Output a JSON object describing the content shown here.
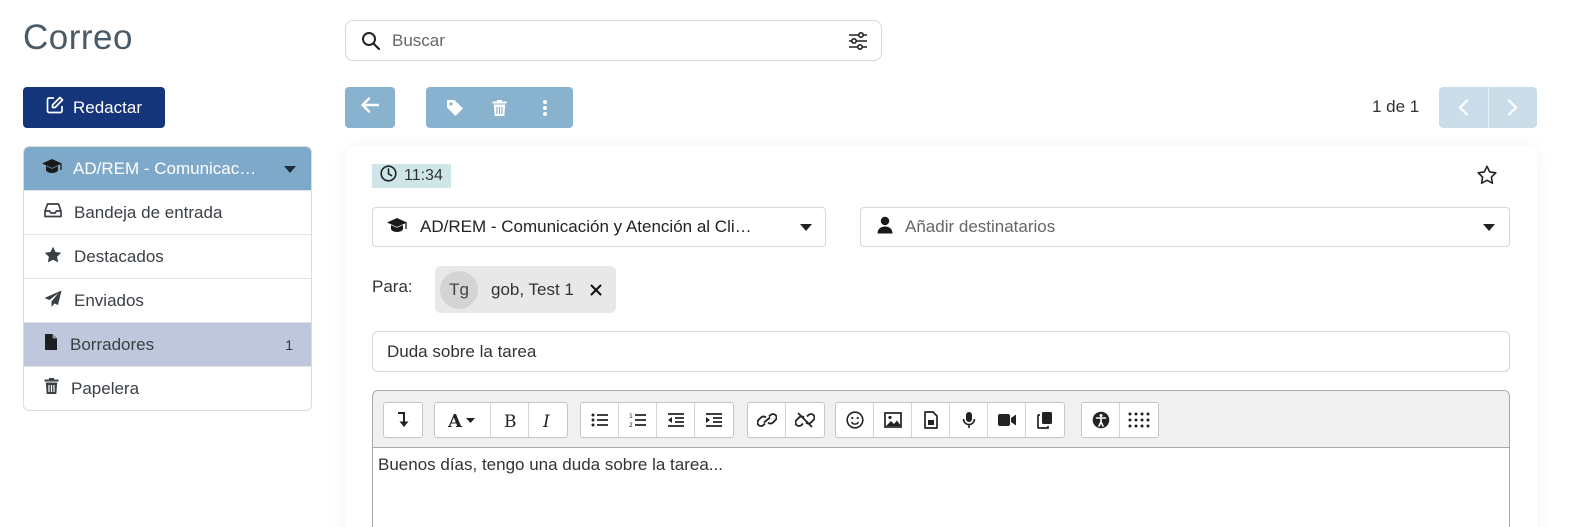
{
  "app": {
    "title": "Correo"
  },
  "search": {
    "placeholder": "Buscar",
    "value": ""
  },
  "compose": {
    "label": "Redactar"
  },
  "sidebar": {
    "account": "AD/REM - Comunicac…",
    "folders": [
      {
        "label": "Bandeja de entrada",
        "icon": "inbox-icon",
        "count": ""
      },
      {
        "label": "Destacados",
        "icon": "star-icon",
        "count": ""
      },
      {
        "label": "Enviados",
        "icon": "paper-plane-icon",
        "count": ""
      },
      {
        "label": "Borradores",
        "icon": "file-icon",
        "count": "1",
        "active": true
      },
      {
        "label": "Papelera",
        "icon": "trash-icon",
        "count": ""
      }
    ]
  },
  "pager": {
    "text": "1 de 1"
  },
  "message": {
    "time": "11:34",
    "from": "AD/REM - Comunicación y Atención al Cli…",
    "to_placeholder": "Añadir destinatarios",
    "para_label": "Para:",
    "recipient": {
      "initials": "Tg",
      "name": "gob, Test 1"
    },
    "subject": "Duda sobre la tarea",
    "body": "Buenos días, tengo una duda sobre la tarea..."
  },
  "colors": {
    "accent": "#14357a",
    "toolbar": "#89b2cf",
    "account_bar": "#7fa9c9",
    "active_folder": "#bec7dc",
    "time_badge": "#cfe6e8"
  }
}
